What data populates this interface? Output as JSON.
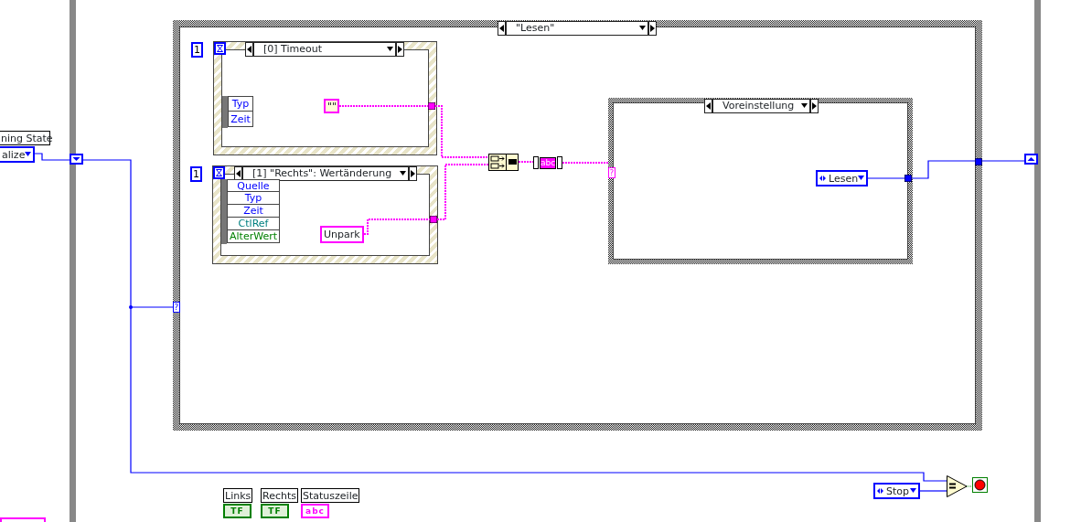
{
  "while_loop": {
    "shift_register_label": "ning State",
    "shift_register_value": "alize"
  },
  "case_structure": {
    "selector": "\"Lesen\"",
    "selector_terminal": "?"
  },
  "event_structures": [
    {
      "timeout": "1",
      "selector": "[0] Timeout",
      "constant": "\"\"",
      "data_nodes": [
        {
          "label": "Typ",
          "color": "#0000ff"
        },
        {
          "label": "Zeit",
          "color": "#0000ff"
        }
      ]
    },
    {
      "timeout": "1",
      "selector": "[1] \"Rechts\": Wertänderung",
      "constant": "Unpark",
      "data_nodes": [
        {
          "label": "Quelle",
          "color": "#0000ff"
        },
        {
          "label": "Typ",
          "color": "#0000ff"
        },
        {
          "label": "Zeit",
          "color": "#0000ff"
        },
        {
          "label": "CtlRef",
          "color": "#008080"
        },
        {
          "label": "AlterWert",
          "color": "#008000"
        }
      ]
    }
  ],
  "string_node": "abc",
  "inner_case": {
    "selector": "Voreinstellung",
    "selector_terminal": "?",
    "enum_constant": "Lesen"
  },
  "stop_constant": "Stop",
  "terminals": [
    {
      "label": "Links",
      "kind": "boolean",
      "value": "TF"
    },
    {
      "label": "Rechts",
      "kind": "boolean",
      "value": "TF"
    },
    {
      "label": "Statuszeile",
      "kind": "string",
      "value": "abc"
    }
  ]
}
